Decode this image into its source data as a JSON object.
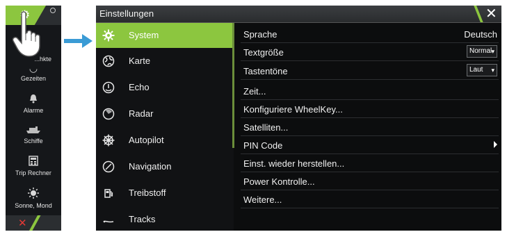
{
  "left_strip": {
    "items": [
      {
        "label": "...hkte",
        "icon": "waypoint-icon"
      },
      {
        "label": "Gezeiten",
        "icon": "tide-icon"
      },
      {
        "label": "Alarme",
        "icon": "bell-icon"
      },
      {
        "label": "Schiffe",
        "icon": "ship-icon"
      },
      {
        "label": "Trip Rechner",
        "icon": "trip-calculator-icon"
      },
      {
        "label": "Sonne, Mond",
        "icon": "sun-moon-icon"
      }
    ]
  },
  "dialog": {
    "title": "Einstellungen",
    "close_icon": "close-icon"
  },
  "menu": {
    "items": [
      {
        "label": "System",
        "icon": "gear-icon"
      },
      {
        "label": "Karte",
        "icon": "globe-icon"
      },
      {
        "label": "Echo",
        "icon": "sonar-icon"
      },
      {
        "label": "Radar",
        "icon": "radar-icon"
      },
      {
        "label": "Autopilot",
        "icon": "helm-icon"
      },
      {
        "label": "Navigation",
        "icon": "compass-icon"
      },
      {
        "label": "Treibstoff",
        "icon": "fuel-pump-icon"
      },
      {
        "label": "Tracks",
        "icon": "track-icon"
      }
    ],
    "selected_index": 0
  },
  "settings": {
    "language_label": "Sprache",
    "language_value": "Deutsch",
    "textsize_label": "Textgröße",
    "textsize_value": "Normal",
    "keytone_label": "Tastentöne",
    "keytone_value": "Laut",
    "time_label": "Zeit...",
    "wheelkey_label": "Konfiguriere WheelKey...",
    "satellites_label": "Satelliten...",
    "pin_label": "PIN Code",
    "restore_label": "Einst. wieder herstellen...",
    "power_label": "Power Kontrolle...",
    "more_label": "Weitere..."
  },
  "colors": {
    "accent": "#8cc63f",
    "background": "#0c0d0e",
    "arrow": "#3a9bd5"
  }
}
